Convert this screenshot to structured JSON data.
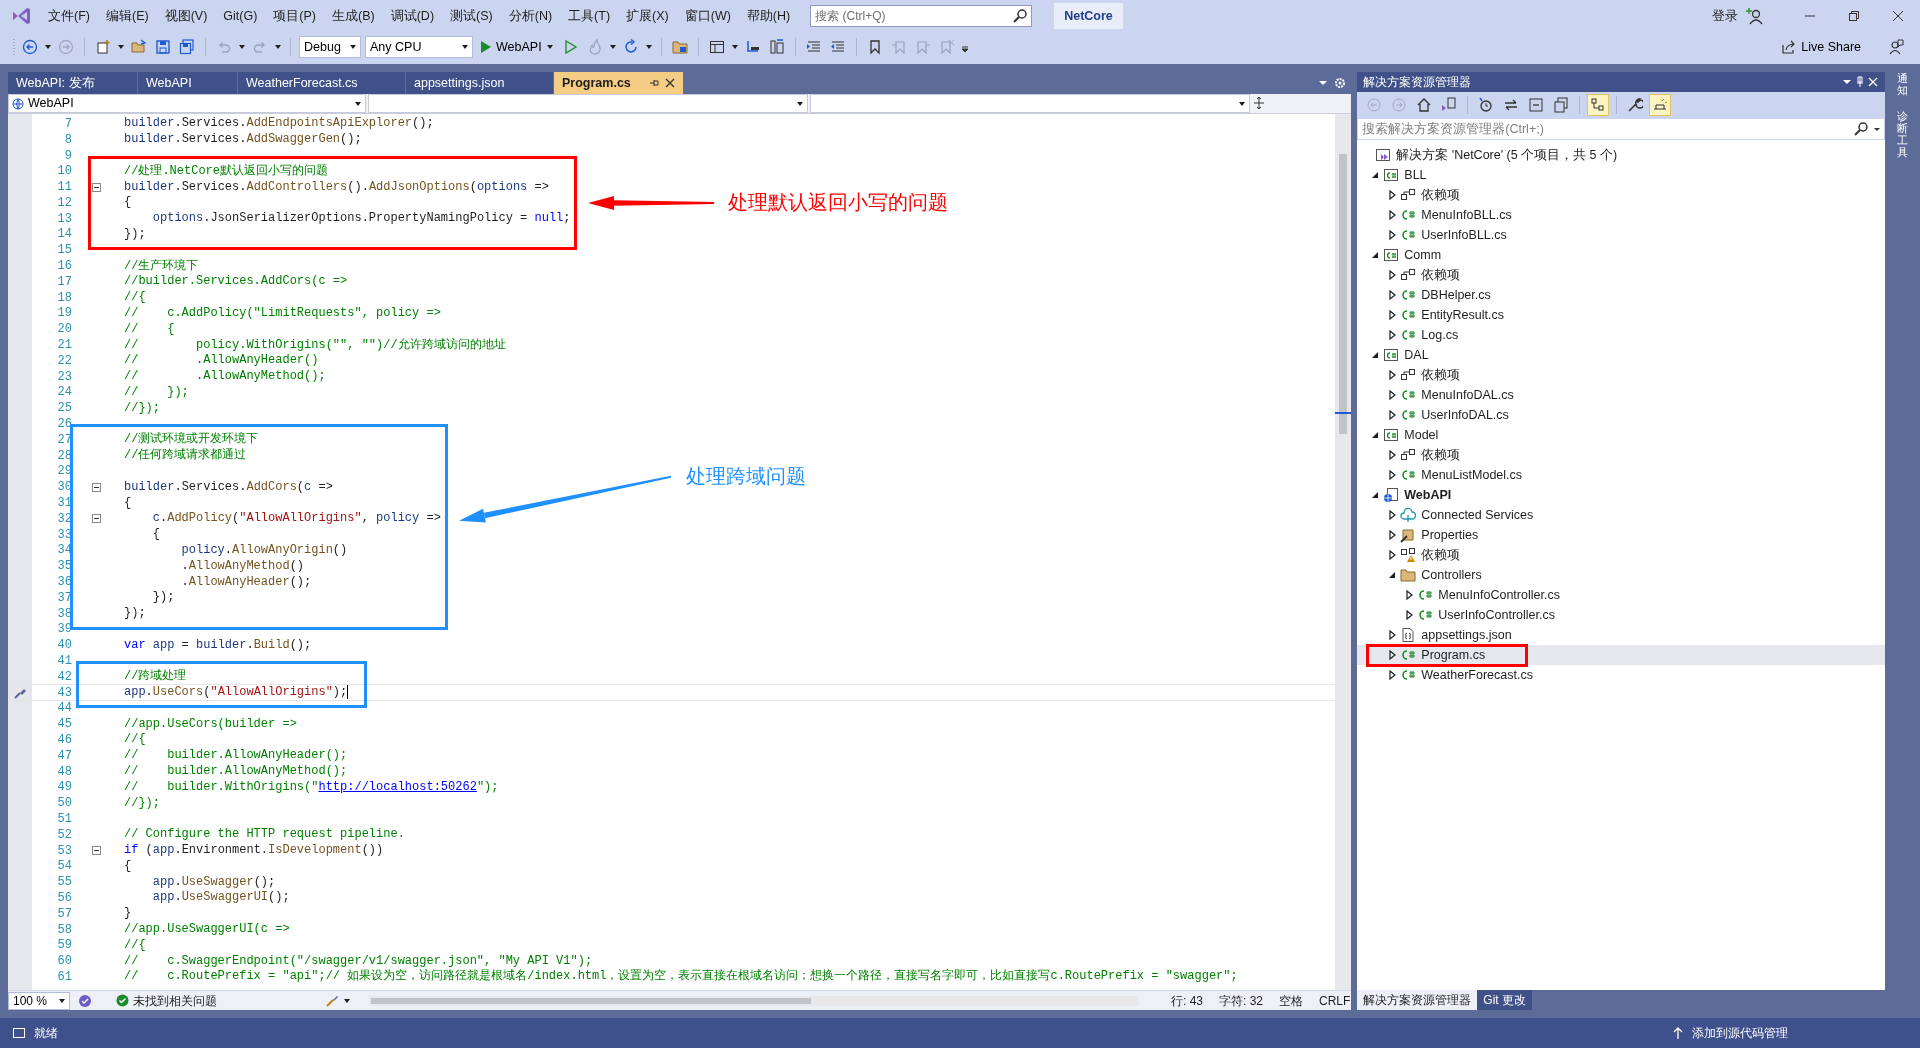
{
  "title_bar": {
    "menu": [
      "文件(F)",
      "编辑(E)",
      "视图(V)",
      "Git(G)",
      "项目(P)",
      "生成(B)",
      "调试(D)",
      "测试(S)",
      "分析(N)",
      "工具(T)",
      "扩展(X)",
      "窗口(W)",
      "帮助(H)"
    ],
    "search": {
      "placeholder": "搜索 (Ctrl+Q)"
    },
    "solution_name": "NetCore",
    "sign_in": "登录"
  },
  "toolbar": {
    "configuration": "Debug",
    "platform": "Any CPU",
    "run_target": "WebAPI",
    "live_share": "Live Share"
  },
  "document_tabs": [
    {
      "label": "WebAPI: 发布",
      "selected": false
    },
    {
      "label": "WebAPI",
      "selected": false
    },
    {
      "label": "WeatherForecast.cs",
      "selected": false
    },
    {
      "label": "appsettings.json",
      "selected": false
    },
    {
      "label": "Program.cs",
      "selected": true
    }
  ],
  "nav_bar": {
    "project": "WebAPI"
  },
  "editor": {
    "lines": [
      {
        "num": "7",
        "kind": "code",
        "spans": [
          {
            "text": "builder",
            "kind": "var"
          },
          {
            "text": ".",
            "kind": "punct"
          },
          {
            "text": "Services",
            "kind": "type"
          },
          {
            "text": ".",
            "kind": "punct"
          },
          {
            "text": "AddEndpointsApiExplorer",
            "kind": "method"
          },
          {
            "text": "();",
            "kind": "punct"
          }
        ]
      },
      {
        "num": "8",
        "kind": "code",
        "spans": [
          {
            "text": "builder",
            "kind": "var"
          },
          {
            "text": ".",
            "kind": "punct"
          },
          {
            "text": "Services",
            "kind": "type"
          },
          {
            "text": ".",
            "kind": "punct"
          },
          {
            "text": "AddSwaggerGen",
            "kind": "method"
          },
          {
            "text": "();",
            "kind": "punct"
          }
        ]
      },
      {
        "num": "9"
      },
      {
        "num": "10",
        "kind": "comment",
        "text": "//处理.NetCore默认返回小写的问题"
      },
      {
        "num": "11",
        "kind": "code",
        "fold": true,
        "spans": [
          {
            "text": "builder",
            "kind": "var"
          },
          {
            "text": ".",
            "kind": "punct"
          },
          {
            "text": "Services",
            "kind": "type"
          },
          {
            "text": ".",
            "kind": "punct"
          },
          {
            "text": "AddControllers",
            "kind": "method"
          },
          {
            "text": "().",
            "kind": "punct"
          },
          {
            "text": "AddJsonOptions",
            "kind": "method"
          },
          {
            "text": "(",
            "kind": "punct"
          },
          {
            "text": "options",
            "kind": "var"
          },
          {
            "text": " =>",
            "kind": "punct"
          }
        ]
      },
      {
        "num": "12",
        "kind": "code",
        "spans": [
          {
            "text": "{",
            "kind": "punct"
          }
        ]
      },
      {
        "num": "13",
        "kind": "code",
        "spans": [
          {
            "text": "    options",
            "kind": "var"
          },
          {
            "text": ".",
            "kind": "punct"
          },
          {
            "text": "JsonSerializerOptions",
            "kind": "type"
          },
          {
            "text": ".",
            "kind": "punct"
          },
          {
            "text": "PropertyNamingPolicy",
            "kind": "type"
          },
          {
            "text": " = ",
            "kind": "punct"
          },
          {
            "text": "null",
            "kind": "keyword"
          },
          {
            "text": ";",
            "kind": "punct"
          }
        ]
      },
      {
        "num": "14",
        "kind": "code",
        "spans": [
          {
            "text": "});",
            "kind": "punct"
          }
        ]
      },
      {
        "num": "15"
      },
      {
        "num": "16",
        "kind": "comment",
        "text": "//生产环境下"
      },
      {
        "num": "17",
        "kind": "comment",
        "text": "//builder.Services.AddCors(c =>"
      },
      {
        "num": "18",
        "kind": "comment",
        "text": "//{"
      },
      {
        "num": "19",
        "kind": "comment",
        "text": "//    c.AddPolicy(\"LimitRequests\", policy =>"
      },
      {
        "num": "20",
        "kind": "comment",
        "text": "//    {"
      },
      {
        "num": "21",
        "kind": "comment",
        "text": "//        policy.WithOrigins(\"\", \"\")//允许跨域访问的地址"
      },
      {
        "num": "22",
        "kind": "comment",
        "text": "//        .AllowAnyHeader()"
      },
      {
        "num": "23",
        "kind": "comment",
        "text": "//        .AllowAnyMethod();"
      },
      {
        "num": "24",
        "kind": "comment",
        "text": "//    });"
      },
      {
        "num": "25",
        "kind": "comment",
        "text": "//});"
      },
      {
        "num": "26"
      },
      {
        "num": "27",
        "kind": "comment",
        "text": "//测试环境或开发环境下"
      },
      {
        "num": "28",
        "kind": "comment",
        "text": "//任何跨域请求都通过"
      },
      {
        "num": "29"
      },
      {
        "num": "30",
        "kind": "code",
        "fold": true,
        "spans": [
          {
            "text": "builder",
            "kind": "var"
          },
          {
            "text": ".",
            "kind": "punct"
          },
          {
            "text": "Services",
            "kind": "type"
          },
          {
            "text": ".",
            "kind": "punct"
          },
          {
            "text": "AddCors",
            "kind": "method"
          },
          {
            "text": "(",
            "kind": "punct"
          },
          {
            "text": "c",
            "kind": "var"
          },
          {
            "text": " =>",
            "kind": "punct"
          }
        ]
      },
      {
        "num": "31",
        "kind": "code",
        "spans": [
          {
            "text": "{",
            "kind": "punct"
          }
        ]
      },
      {
        "num": "32",
        "kind": "code",
        "fold": true,
        "spans": [
          {
            "text": "    c",
            "kind": "var"
          },
          {
            "text": ".",
            "kind": "punct"
          },
          {
            "text": "AddPolicy",
            "kind": "method"
          },
          {
            "text": "(",
            "kind": "punct"
          },
          {
            "text": "\"AllowAllOrigins\"",
            "kind": "string"
          },
          {
            "text": ", ",
            "kind": "punct"
          },
          {
            "text": "policy",
            "kind": "var"
          },
          {
            "text": " =>",
            "kind": "punct"
          }
        ]
      },
      {
        "num": "33",
        "kind": "code",
        "spans": [
          {
            "text": "    {",
            "kind": "punct"
          }
        ]
      },
      {
        "num": "34",
        "kind": "code",
        "spans": [
          {
            "text": "        policy",
            "kind": "var"
          },
          {
            "text": ".",
            "kind": "punct"
          },
          {
            "text": "AllowAnyOrigin",
            "kind": "method"
          },
          {
            "text": "()",
            "kind": "punct"
          }
        ]
      },
      {
        "num": "35",
        "kind": "code",
        "spans": [
          {
            "text": "        .",
            "kind": "punct"
          },
          {
            "text": "AllowAnyMethod",
            "kind": "method"
          },
          {
            "text": "()",
            "kind": "punct"
          }
        ]
      },
      {
        "num": "36",
        "kind": "code",
        "spans": [
          {
            "text": "        .",
            "kind": "punct"
          },
          {
            "text": "AllowAnyHeader",
            "kind": "method"
          },
          {
            "text": "();",
            "kind": "punct"
          }
        ]
      },
      {
        "num": "37",
        "kind": "code",
        "spans": [
          {
            "text": "    });",
            "kind": "punct"
          }
        ]
      },
      {
        "num": "38",
        "kind": "code",
        "spans": [
          {
            "text": "});",
            "kind": "punct"
          }
        ]
      },
      {
        "num": "39"
      },
      {
        "num": "40",
        "kind": "code",
        "spans": [
          {
            "text": "var",
            "kind": "keyword"
          },
          {
            "text": " app",
            "kind": "var"
          },
          {
            "text": " = ",
            "kind": "punct"
          },
          {
            "text": "builder",
            "kind": "var"
          },
          {
            "text": ".",
            "kind": "punct"
          },
          {
            "text": "Build",
            "kind": "method"
          },
          {
            "text": "();",
            "kind": "punct"
          }
        ]
      },
      {
        "num": "41"
      },
      {
        "num": "42",
        "kind": "comment",
        "text": "//跨域处理"
      },
      {
        "num": "43",
        "kind": "code",
        "current": true,
        "quick_action": true,
        "spans": [
          {
            "text": "app",
            "kind": "var"
          },
          {
            "text": ".",
            "kind": "punct"
          },
          {
            "text": "UseCors",
            "kind": "method"
          },
          {
            "text": "(",
            "kind": "punct"
          },
          {
            "text": "\"AllowAllOrigins\"",
            "kind": "string"
          },
          {
            "text": ");",
            "kind": "punct"
          }
        ]
      },
      {
        "num": "44"
      },
      {
        "num": "45",
        "kind": "comment",
        "text": "//app.UseCors(builder =>"
      },
      {
        "num": "46",
        "kind": "comment",
        "text": "//{"
      },
      {
        "num": "47",
        "kind": "comment",
        "text": "//    builder.AllowAnyHeader();"
      },
      {
        "num": "48",
        "kind": "comment",
        "text": "//    builder.AllowAnyMethod();"
      },
      {
        "num": "49",
        "kind": "comment_link",
        "text": "//    builder.WithOrigins(\"",
        "link": "http://localhost:50262",
        "rest": "\");"
      },
      {
        "num": "50",
        "kind": "comment",
        "text": "//});"
      },
      {
        "num": "51"
      },
      {
        "num": "52",
        "kind": "comment",
        "text": "// Configure the HTTP request pipeline."
      },
      {
        "num": "53",
        "kind": "code",
        "fold": true,
        "spans": [
          {
            "text": "if",
            "kind": "keyword"
          },
          {
            "text": " (",
            "kind": "punct"
          },
          {
            "text": "app",
            "kind": "var"
          },
          {
            "text": ".",
            "kind": "punct"
          },
          {
            "text": "Environment",
            "kind": "type"
          },
          {
            "text": ".",
            "kind": "punct"
          },
          {
            "text": "IsDevelopment",
            "kind": "method"
          },
          {
            "text": "())",
            "kind": "punct"
          }
        ]
      },
      {
        "num": "54",
        "kind": "code",
        "spans": [
          {
            "text": "{",
            "kind": "punct"
          }
        ]
      },
      {
        "num": "55",
        "kind": "code",
        "spans": [
          {
            "text": "    app",
            "kind": "var"
          },
          {
            "text": ".",
            "kind": "punct"
          },
          {
            "text": "UseSwagger",
            "kind": "method"
          },
          {
            "text": "();",
            "kind": "punct"
          }
        ]
      },
      {
        "num": "56",
        "kind": "code",
        "spans": [
          {
            "text": "    app",
            "kind": "var"
          },
          {
            "text": ".",
            "kind": "punct"
          },
          {
            "text": "UseSwaggerUI",
            "kind": "method"
          },
          {
            "text": "();",
            "kind": "punct"
          }
        ]
      },
      {
        "num": "57",
        "kind": "code",
        "spans": [
          {
            "text": "}",
            "kind": "punct"
          }
        ]
      },
      {
        "num": "58",
        "kind": "comment",
        "text": "//app.UseSwaggerUI(c =>"
      },
      {
        "num": "59",
        "kind": "comment",
        "text": "//{"
      },
      {
        "num": "60",
        "kind": "comment",
        "text": "//    c.SwaggerEndpoint(\"/swagger/v1/swagger.json\", \"My API V1\");"
      },
      {
        "num": "61",
        "kind": "comment",
        "text": "//    c.RoutePrefix = \"api\";// 如果设为空，访问路径就是根域名/index.html，设置为空，表示直接在根域名访问；想换一个路径，直接写名字即可，比如直接写c.RoutePrefix = \"swagger\";"
      }
    ]
  },
  "editor_status": {
    "zoom": "100 %",
    "issues": "未找到相关问题",
    "line": "行: 43",
    "char": "字符: 32",
    "spacing": "空格",
    "line_ending": "CRLF"
  },
  "solution_explorer": {
    "title": "解决方案资源管理器",
    "search": {
      "placeholder": "搜索解决方案资源管理器(Ctrl+;)"
    },
    "tools": [
      {
        "kind": "back",
        "on": false
      },
      {
        "kind": "forward",
        "on": false
      },
      {
        "kind": "home",
        "on": false
      },
      {
        "kind": "switch_views",
        "on": false
      },
      {
        "kind": "pending_changes",
        "on": false
      },
      {
        "kind": "sync",
        "on": false
      },
      {
        "kind": "collapse",
        "on": false
      },
      {
        "kind": "show_all",
        "on": false
      },
      {
        "kind": "tree_view",
        "on": true
      },
      {
        "kind": "properties",
        "on": false
      },
      {
        "kind": "preview",
        "on": true
      }
    ],
    "tree": [
      {
        "label": "解决方案 'NetCore' (5 个项目，共 5 个)",
        "kind": "solution",
        "selected": false,
        "children": [
          {
            "label": "BLL",
            "kind": "project",
            "expanded": true,
            "startup": false,
            "selected": false,
            "children": [
              {
                "label": "依赖项",
                "kind": "dependencies",
                "expanded": false,
                "selected": false
              },
              {
                "label": "MenuInfoBLL.cs",
                "kind": "csharp",
                "expanded": false,
                "selected": false
              },
              {
                "label": "UserInfoBLL.cs",
                "kind": "csharp",
                "expanded": false,
                "selected": false
              }
            ]
          },
          {
            "label": "Comm",
            "kind": "project",
            "expanded": true,
            "startup": false,
            "selected": false,
            "children": [
              {
                "label": "依赖项",
                "kind": "dependencies",
                "expanded": false,
                "selected": false
              },
              {
                "label": "DBHelper.cs",
                "kind": "csharp",
                "expanded": false,
                "selected": false
              },
              {
                "label": "EntityResult.cs",
                "kind": "csharp",
                "expanded": false,
                "selected": false
              },
              {
                "label": "Log.cs",
                "kind": "csharp",
                "expanded": false,
                "selected": false
              }
            ]
          },
          {
            "label": "DAL",
            "kind": "project",
            "expanded": true,
            "startup": false,
            "selected": false,
            "children": [
              {
                "label": "依赖项",
                "kind": "dependencies",
                "expanded": false,
                "selected": false
              },
              {
                "label": "MenuInfoDAL.cs",
                "kind": "csharp",
                "expanded": false,
                "selected": false
              },
              {
                "label": "UserInfoDAL.cs",
                "kind": "csharp",
                "expanded": false,
                "selected": false
              }
            ]
          },
          {
            "label": "Model",
            "kind": "project",
            "expanded": true,
            "startup": false,
            "selected": false,
            "children": [
              {
                "label": "依赖项",
                "kind": "dependencies",
                "expanded": false,
                "selected": false
              },
              {
                "label": "MenuListModel.cs",
                "kind": "csharp",
                "expanded": false,
                "selected": false
              }
            ]
          },
          {
            "label": "WebAPI",
            "kind": "webproject",
            "expanded": true,
            "startup": true,
            "selected": false,
            "children": [
              {
                "label": "Connected Services",
                "kind": "connected",
                "expanded": false,
                "selected": false
              },
              {
                "label": "Properties",
                "kind": "properties",
                "expanded": false,
                "selected": false
              },
              {
                "label": "依赖项",
                "kind": "dependencies_warning",
                "expanded": false,
                "selected": false
              },
              {
                "label": "Controllers",
                "kind": "folder",
                "expanded": true,
                "selected": false,
                "children": [
                  {
                    "label": "MenuInfoController.cs",
                    "kind": "csharp",
                    "expanded": false,
                    "selected": false
                  },
                  {
                    "label": "UserInfoController.cs",
                    "kind": "csharp",
                    "expanded": false,
                    "selected": false
                  }
                ]
              },
              {
                "label": "appsettings.json",
                "kind": "json",
                "expanded": false,
                "selected": false
              },
              {
                "label": "Program.cs",
                "kind": "csharp",
                "expanded": false,
                "selected": true
              },
              {
                "label": "WeatherForecast.cs",
                "kind": "csharp",
                "expanded": false,
                "selected": false
              }
            ]
          }
        ]
      }
    ],
    "bottom_tabs": [
      {
        "label": "解决方案资源管理器",
        "selected": true
      },
      {
        "label": "Git 更改",
        "selected": false
      }
    ]
  },
  "side_strip": [
    "通知",
    "诊断工具"
  ],
  "annotations": [
    {
      "kind": "callout",
      "color": "#ff0000",
      "text": "处理默认返回小写的问题"
    },
    {
      "kind": "callout",
      "color": "#1e90ff",
      "text": "处理跨域问题"
    },
    {
      "kind": "frame",
      "color": "#1e90ff"
    },
    {
      "kind": "frame",
      "color": "#ff0000"
    }
  ],
  "status_bar": {
    "left": "就绪",
    "right": "添加到源代码管理"
  }
}
